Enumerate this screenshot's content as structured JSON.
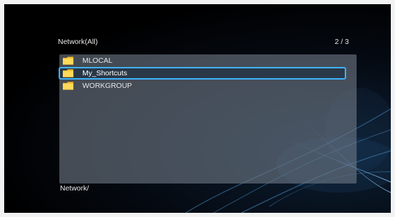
{
  "header": {
    "title": "Network(All)",
    "page_indicator": "2 / 3"
  },
  "list": {
    "items": [
      {
        "label": "MLOCAL",
        "icon": "folder-icon",
        "selected": false
      },
      {
        "label": "My_Shortcuts",
        "icon": "folder-icon",
        "selected": true
      },
      {
        "label": "WORKGROUP",
        "icon": "folder-icon",
        "selected": false
      }
    ]
  },
  "footer": {
    "path": "Network/"
  },
  "colors": {
    "background": "#000000",
    "panel": "#6e7884",
    "selection_border": "#3fb4ff",
    "folder": "#f5c23a",
    "text": "#e8e8e8"
  }
}
